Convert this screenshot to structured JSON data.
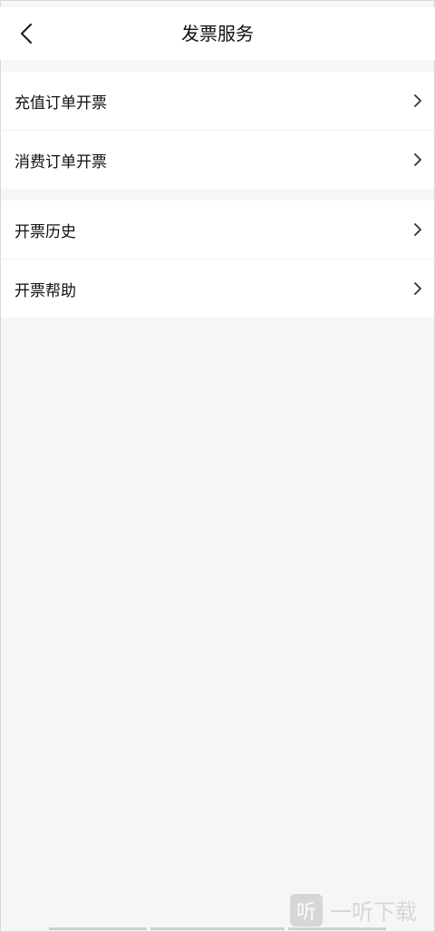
{
  "header": {
    "title": "发票服务"
  },
  "groups": [
    {
      "items": [
        {
          "label": "充值订单开票"
        },
        {
          "label": "消费订单开票"
        }
      ]
    },
    {
      "items": [
        {
          "label": "开票历史"
        },
        {
          "label": "开票帮助"
        }
      ]
    }
  ],
  "watermark": {
    "brand": "一听下载"
  },
  "colors": {
    "background": "#f6f6f6",
    "card": "#ffffff",
    "text": "#111111",
    "chevron": "#333333"
  }
}
